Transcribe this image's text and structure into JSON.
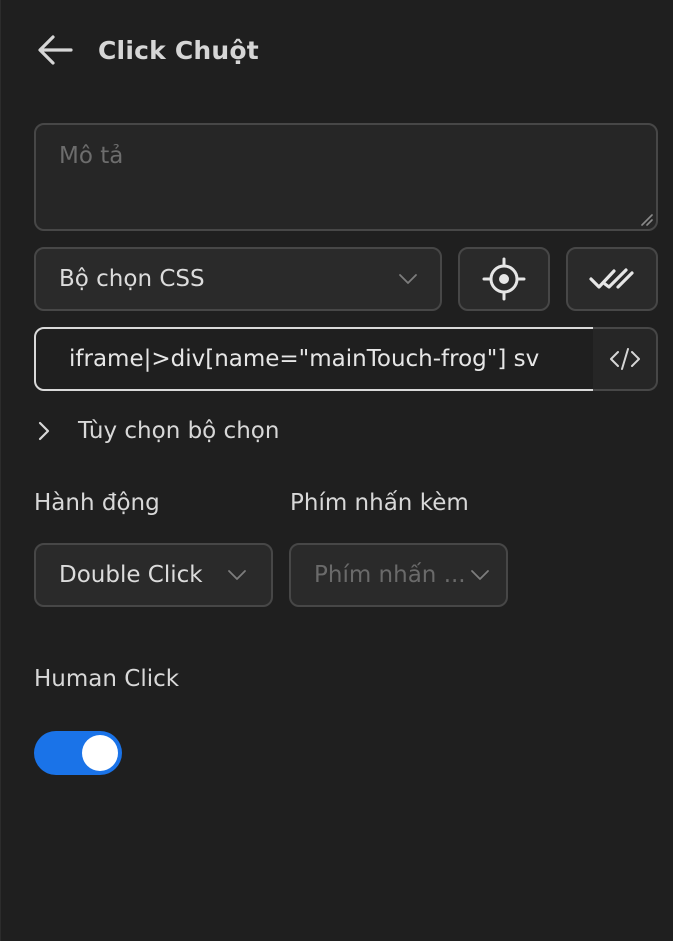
{
  "header": {
    "title": "Click Chuột",
    "back_icon": "arrow-left-icon"
  },
  "description": {
    "placeholder": "Mô tả",
    "value": ""
  },
  "selector_type": {
    "selected": "Bộ chọn CSS"
  },
  "selector": {
    "value": "iframe|>div[name=\"mainTouch-frog\"] sv"
  },
  "selector_options": {
    "label": "Tùy chọn bộ chọn"
  },
  "action": {
    "label": "Hành động",
    "selected": "Double Click"
  },
  "modifier": {
    "label": "Phím nhấn kèm",
    "placeholder": "Phím nhấn ..."
  },
  "human_click": {
    "label": "Human Click",
    "enabled": true
  },
  "colors": {
    "background": "#1f1f1f",
    "accent": "#1a73e8",
    "border": "#474747"
  }
}
